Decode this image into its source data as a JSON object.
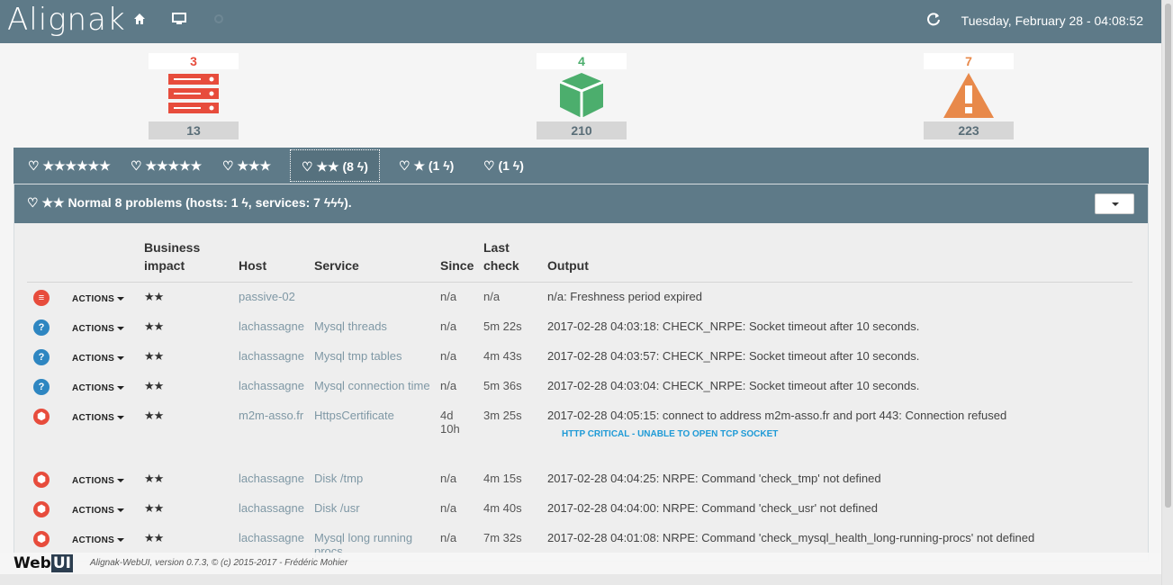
{
  "topbar": {
    "logo": "Alignak",
    "datetime": "Tuesday, February 28 - 04:08:52",
    "icons": [
      "home-icon",
      "monitor-icon",
      "settings-icon",
      "refresh-icon"
    ]
  },
  "counters": [
    {
      "name": "hosts",
      "problems": "3",
      "total": "13",
      "color": "#e74c3c"
    },
    {
      "name": "services",
      "problems": "4",
      "total": "210",
      "color": "#4cae6d"
    },
    {
      "name": "warnings",
      "problems": "7",
      "total": "223",
      "color": "#e8894a"
    }
  ],
  "tabs": [
    {
      "label": "★★★★★★"
    },
    {
      "label": "★★★★★"
    },
    {
      "label": "★★★"
    },
    {
      "label": "★★ (8 ϟ)"
    },
    {
      "label": "★ (1 ϟ)"
    },
    {
      "label": "(1 ϟ)"
    }
  ],
  "panel": {
    "title": "★★ Normal 8 problems (hosts: 1 ϟ, services: 7 ϟϟϟ).",
    "columns": {
      "business_impact": "Business impact",
      "host": "Host",
      "service": "Service",
      "since": "Since",
      "last_check": "Last check",
      "output": "Output"
    },
    "actions_label": "ACTIONS",
    "rows": [
      {
        "state": "host-down",
        "stars": "★★",
        "host": "passive-02",
        "service": "",
        "since": "n/a",
        "last_check": "n/a",
        "output": "n/a: Freshness period expired",
        "sub": ""
      },
      {
        "state": "unknown",
        "stars": "★★",
        "host": "lachassagne",
        "service": "Mysql threads",
        "since": "n/a",
        "last_check": "5m 22s",
        "output": "2017-02-28 04:03:18: CHECK_NRPE: Socket timeout after 10 seconds.",
        "sub": ""
      },
      {
        "state": "unknown",
        "stars": "★★",
        "host": "lachassagne",
        "service": "Mysql tmp tables",
        "since": "n/a",
        "last_check": "4m 43s",
        "output": "2017-02-28 04:03:57: CHECK_NRPE: Socket timeout after 10 seconds.",
        "sub": ""
      },
      {
        "state": "unknown",
        "stars": "★★",
        "host": "lachassagne",
        "service": "Mysql connection time",
        "since": "n/a",
        "last_check": "5m 36s",
        "output": "2017-02-28 04:03:04: CHECK_NRPE: Socket timeout after 10 seconds.",
        "sub": ""
      },
      {
        "state": "critical",
        "stars": "★★",
        "host": "m2m-asso.fr",
        "service": "HttpsCertificate",
        "since": "4d 10h",
        "last_check": "3m 25s",
        "output": "2017-02-28 04:05:15: connect to address m2m-asso.fr and port 443: Connection refused",
        "sub": "HTTP CRITICAL - UNABLE TO OPEN TCP SOCKET"
      },
      {
        "state": "critical",
        "stars": "★★",
        "host": "lachassagne",
        "service": "Disk /tmp",
        "since": "n/a",
        "last_check": "4m 15s",
        "output": "2017-02-28 04:04:25: NRPE: Command 'check_tmp' not defined",
        "sub": ""
      },
      {
        "state": "critical",
        "stars": "★★",
        "host": "lachassagne",
        "service": "Disk /usr",
        "since": "n/a",
        "last_check": "4m 40s",
        "output": "2017-02-28 04:04:00: NRPE: Command 'check_usr' not defined",
        "sub": ""
      },
      {
        "state": "critical",
        "stars": "★★",
        "host": "lachassagne",
        "service": "Mysql long running procs",
        "since": "n/a",
        "last_check": "7m 32s",
        "output": "2017-02-28 04:01:08: NRPE: Command 'check_mysql_health_long-running-procs' not defined",
        "sub": ""
      }
    ]
  },
  "footer": {
    "brand": "Web UI",
    "text": "Alignak-WebUI, version 0.7.3, © (c) 2015-2017 - Frédéric Mohier"
  }
}
